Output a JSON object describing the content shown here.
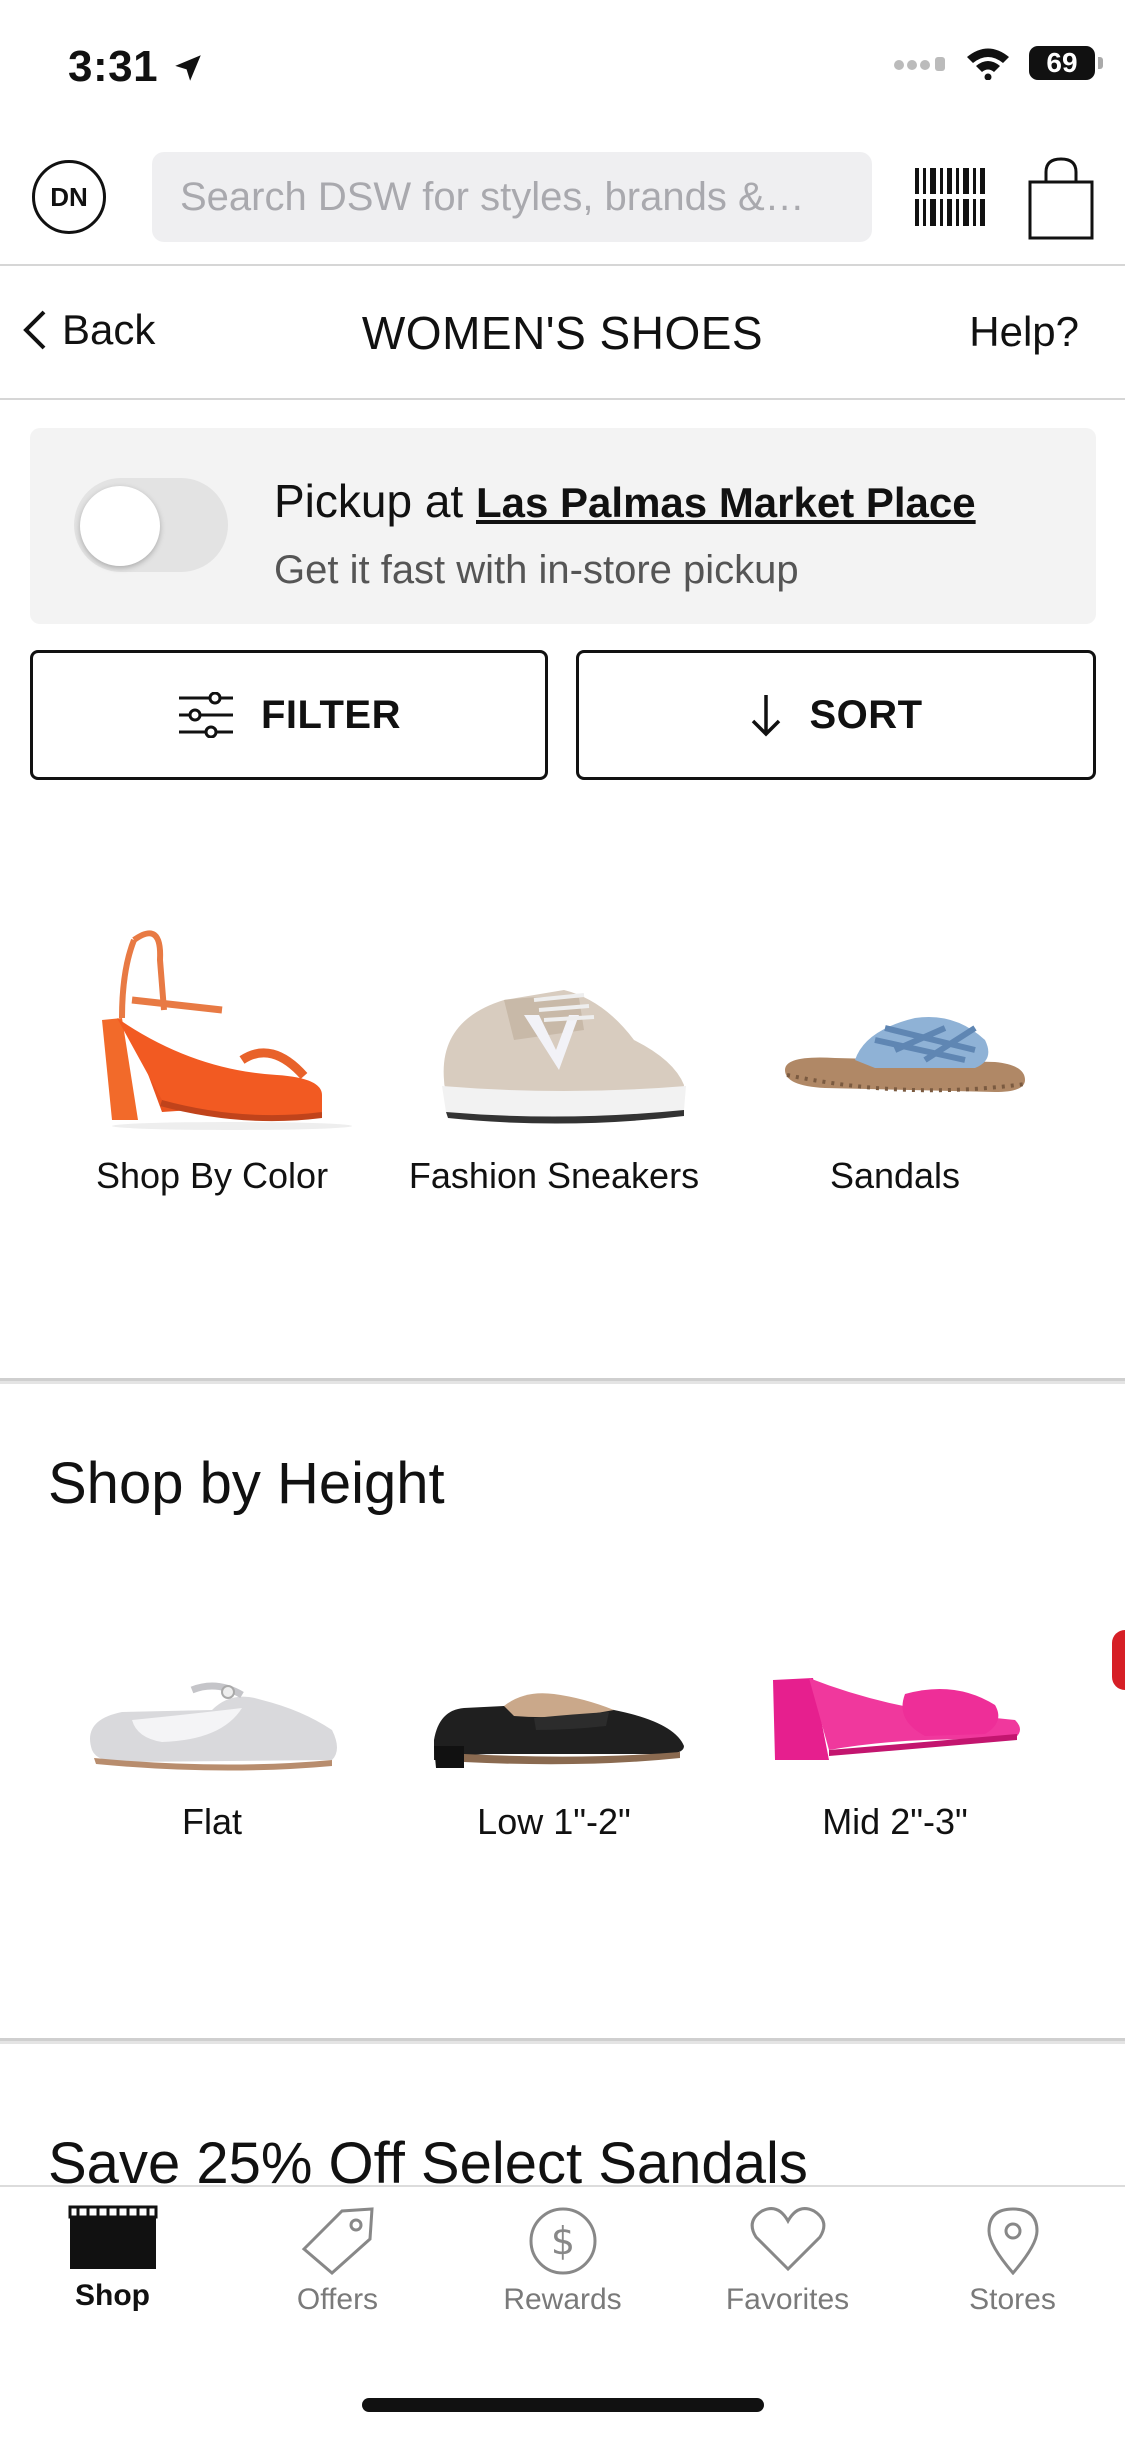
{
  "status_bar": {
    "time": "3:31",
    "battery": "69"
  },
  "header": {
    "avatar_initials": "DN",
    "search_placeholder": "Search DSW for styles, brands &…"
  },
  "nav": {
    "back_label": "Back",
    "title": "WOMEN'S SHOES",
    "help_label": "Help?"
  },
  "pickup": {
    "prefix": "Pickup at ",
    "store_name": "Las Palmas Market Place",
    "subtitle": "Get it fast with in-store pickup",
    "toggle_on": false
  },
  "actions": {
    "filter_label": "FILTER",
    "sort_label": "SORT"
  },
  "categories": [
    {
      "label": "Shop By Color",
      "icon": "orange-sandal-image"
    },
    {
      "label": "Fashion Sneakers",
      "icon": "sneaker-image"
    },
    {
      "label": "Sandals",
      "icon": "slide-sandal-image"
    }
  ],
  "height_section": {
    "title": "Shop by Height",
    "items": [
      {
        "label": "Flat",
        "icon": "silver-flat-image"
      },
      {
        "label": "Low 1\"-2\"",
        "icon": "black-loafer-image"
      },
      {
        "label": "Mid 2\"-3\"",
        "icon": "pink-mule-image"
      }
    ]
  },
  "promo_section": {
    "title": "Save 25% Off Select Sandals"
  },
  "tab_bar": [
    {
      "label": "Shop",
      "icon": "store-icon",
      "active": true
    },
    {
      "label": "Offers",
      "icon": "tag-icon",
      "active": false
    },
    {
      "label": "Rewards",
      "icon": "dollar-circle-icon",
      "active": false
    },
    {
      "label": "Favorites",
      "icon": "heart-icon",
      "active": false
    },
    {
      "label": "Stores",
      "icon": "location-pin-icon",
      "active": false
    }
  ],
  "colors": {
    "accent": "#111111",
    "pickup_bg": "#f3f3f3",
    "search_bg": "#efeff1"
  }
}
